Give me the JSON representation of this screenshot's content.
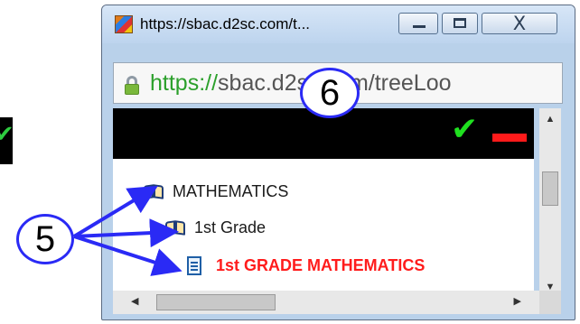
{
  "window": {
    "title": "https://sbac.d2sc.com/t...",
    "controls": {
      "minimize": "minimize",
      "maximize": "maximize",
      "close": "X"
    }
  },
  "addressbar": {
    "scheme": "https://",
    "rest": "sbac.d2sc.com/treeLoo"
  },
  "tree": {
    "items": [
      {
        "label": "MATHEMATICS",
        "icon": "book-icon"
      },
      {
        "label": "1st Grade",
        "icon": "book-icon"
      },
      {
        "label": "1st GRADE MATHEMATICS",
        "icon": "document-icon"
      }
    ]
  },
  "annotations": {
    "callout_6": "6",
    "callout_5": "5"
  },
  "colors": {
    "check": "#1fe01f",
    "remove": "#ff1a1a",
    "selected_text": "#ff1c1c",
    "callout_border": "#2a2af5",
    "url_scheme": "#2ca02c"
  }
}
